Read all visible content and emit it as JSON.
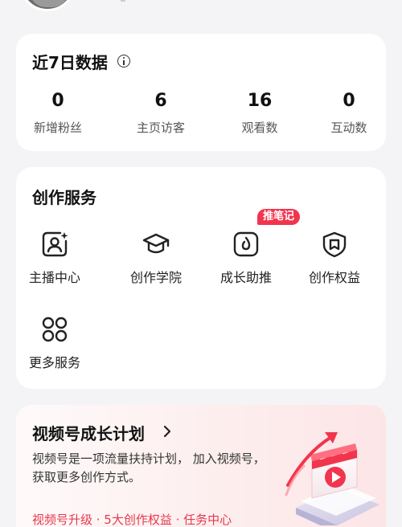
{
  "data_card": {
    "title": "近7日数据",
    "stats": [
      {
        "value": "0",
        "label": "新增粉丝"
      },
      {
        "value": "6",
        "label": "主页访客"
      },
      {
        "value": "16",
        "label": "观看数"
      },
      {
        "value": "0",
        "label": "互动数"
      }
    ]
  },
  "services_card": {
    "title": "创作服务",
    "items": [
      {
        "label": "主播中心",
        "icon": "anchor-center-icon"
      },
      {
        "label": "创作学院",
        "icon": "graduation-cap-icon"
      },
      {
        "label": "成长助推",
        "icon": "flame-icon",
        "badge": "推笔记"
      },
      {
        "label": "创作权益",
        "icon": "shield-icon"
      },
      {
        "label": "更多服务",
        "icon": "grid-icon"
      }
    ]
  },
  "growth_card": {
    "title": "视频号成长计划",
    "description": "视频号是一项流量扶持计划， 加入视频号，获取更多创作方式。",
    "links": "视频号升级 · 5大创作权益 · 任务中心"
  },
  "colors": {
    "accent": "#f2354e",
    "link": "#e6394d",
    "background": "#f4f4f6",
    "card": "#ffffff"
  }
}
